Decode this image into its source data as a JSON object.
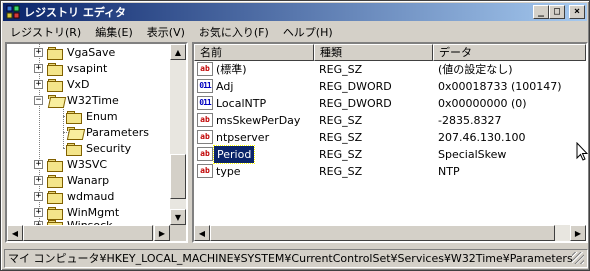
{
  "window": {
    "title": "レジストリ エディタ",
    "controls": {
      "minimize": "_",
      "maximize": "□",
      "close": "×"
    }
  },
  "menu": [
    {
      "label": "レジストリ(R)"
    },
    {
      "label": "編集(E)"
    },
    {
      "label": "表示(V)"
    },
    {
      "label": "お気に入り(F)"
    },
    {
      "label": "ヘルプ(H)"
    }
  ],
  "tree": {
    "items": [
      {
        "label": "VgaSave",
        "expander": "+"
      },
      {
        "label": "vsapint",
        "expander": "+"
      },
      {
        "label": "VxD",
        "expander": "+"
      },
      {
        "label": "W32Time",
        "expander": "−"
      },
      {
        "label": "Enum",
        "expander": ""
      },
      {
        "label": "Parameters",
        "expander": ""
      },
      {
        "label": "Security",
        "expander": ""
      },
      {
        "label": "W3SVC",
        "expander": "+"
      },
      {
        "label": "Wanarp",
        "expander": "+"
      },
      {
        "label": "wdmaud",
        "expander": "+"
      },
      {
        "label": "WinMgmt",
        "expander": "+"
      },
      {
        "label": "Winsock",
        "expander": "+"
      }
    ]
  },
  "list": {
    "headers": {
      "name": "名前",
      "type": "種類",
      "data": "データ"
    },
    "rows": [
      {
        "icon": "ab",
        "name": "(標準)",
        "type": "REG_SZ",
        "data": "(値の設定なし)"
      },
      {
        "icon": "011",
        "name": "Adj",
        "type": "REG_DWORD",
        "data": "0x00018733 (100147)"
      },
      {
        "icon": "011",
        "name": "LocalNTP",
        "type": "REG_DWORD",
        "data": "0x00000000 (0)"
      },
      {
        "icon": "ab",
        "name": "msSkewPerDay",
        "type": "REG_SZ",
        "data": "-2835.8327"
      },
      {
        "icon": "ab",
        "name": "ntpserver",
        "type": "REG_SZ",
        "data": "207.46.130.100"
      },
      {
        "icon": "ab",
        "name": "Period",
        "type": "REG_SZ",
        "data": "SpecialSkew",
        "selected": true
      },
      {
        "icon": "ab",
        "name": "type",
        "type": "REG_SZ",
        "data": "NTP"
      }
    ]
  },
  "statusbar": {
    "path": "マイ コンピュータ¥HKEY_LOCAL_MACHINE¥SYSTEM¥CurrentControlSet¥Services¥W32Time¥Parameters"
  }
}
